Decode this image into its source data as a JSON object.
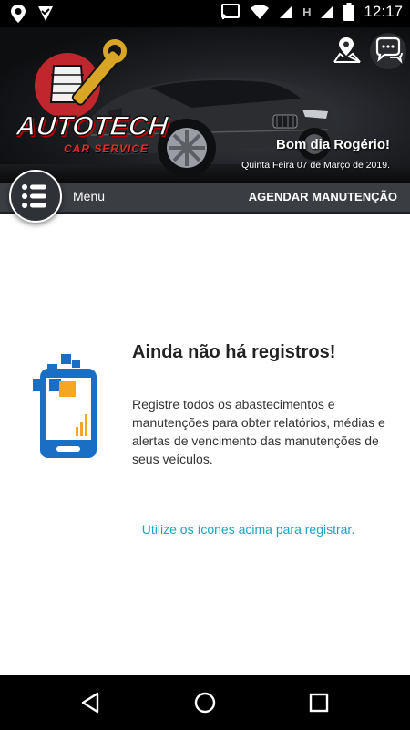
{
  "status_bar": {
    "time": "12:17",
    "network_indicator": "H",
    "left_icons": [
      "location-icon",
      "notification-check-icon"
    ],
    "right_icons": [
      "cast-icon",
      "wifi-icon",
      "signal-icon",
      "signal-icon",
      "battery-icon"
    ]
  },
  "header": {
    "logo": {
      "title": "AUTOTECH",
      "subtitle": "CAR SERVICE"
    },
    "greeting": "Bom dia Rogério!",
    "date": "Quinta Feira 07 de Março de 2019.",
    "actions": [
      "map-pin-icon",
      "chat-icon"
    ]
  },
  "menubar": {
    "menu_label": "Menu",
    "schedule_label": "AGENDAR MANUTENÇÃO"
  },
  "empty_state": {
    "title": "Ainda não há registros!",
    "description": "Registre todos os abastecimentos e manutenções para obter relatórios, médias e alertas de vencimento das manutenções de seus veículos.",
    "hint": "Utilize os ícones acima para registrar."
  },
  "nav_bar": {
    "buttons": [
      "back-icon",
      "home-icon",
      "recents-icon"
    ]
  },
  "colors": {
    "accent": "#1aa3c2",
    "phone_blue": "#1a6fc4",
    "square_orange": "#f5a623",
    "menubar": "#3a3d42"
  }
}
